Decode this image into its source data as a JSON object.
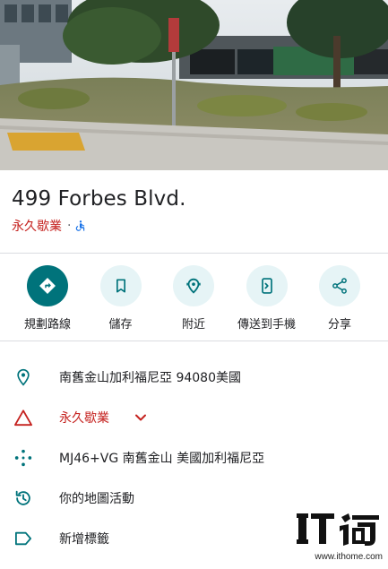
{
  "place": {
    "name": "499 Forbes Blvd.",
    "status": "永久歇業",
    "separator": "·",
    "accessibility_icon": "wheelchair-icon"
  },
  "actions": [
    {
      "label": "規劃路線",
      "icon": "directions-icon"
    },
    {
      "label": "儲存",
      "icon": "bookmark-icon"
    },
    {
      "label": "附近",
      "icon": "nearby-icon"
    },
    {
      "label": "傳送到手機",
      "icon": "send-to-phone-icon"
    },
    {
      "label": "分享",
      "icon": "share-icon"
    }
  ],
  "details": {
    "address": "南舊金山加利福尼亞 94080美國",
    "closed_status": "永久歇業",
    "plus_code": "MJ46+VG 南舊金山 美國加利福尼亞",
    "map_activity": "你的地圖活動",
    "add_label": "新增標籤"
  },
  "watermark": {
    "logo_text": "IT之家",
    "url": "www.ithome.com"
  },
  "colors": {
    "accent": "#00737b",
    "accent_light": "#e6f4f6",
    "closed_red": "#c5221f",
    "divider": "#dadce0"
  }
}
